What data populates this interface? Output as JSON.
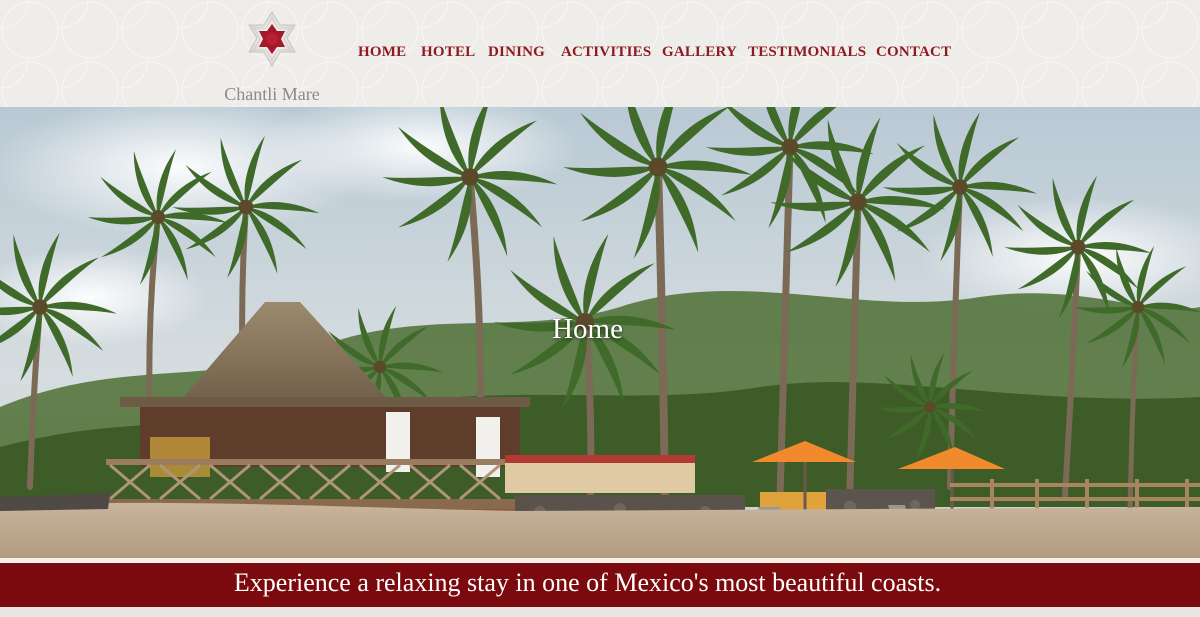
{
  "brand": {
    "name": "Chantli Mare",
    "logo_icon": "star-flower-icon",
    "color": "#8e1a22"
  },
  "nav": {
    "items": [
      {
        "label": "HOME"
      },
      {
        "label": "HOTEL"
      },
      {
        "label": "DINING"
      },
      {
        "label": "ACTIVITIES"
      },
      {
        "label": "GALLERY"
      },
      {
        "label": "TESTIMONIALS"
      },
      {
        "label": "CONTACT"
      }
    ]
  },
  "hero": {
    "title": "Home"
  },
  "banner": {
    "text": "Experience a relaxing stay in one of Mexico's most beautiful coasts.",
    "color": "#7a0a0e"
  }
}
